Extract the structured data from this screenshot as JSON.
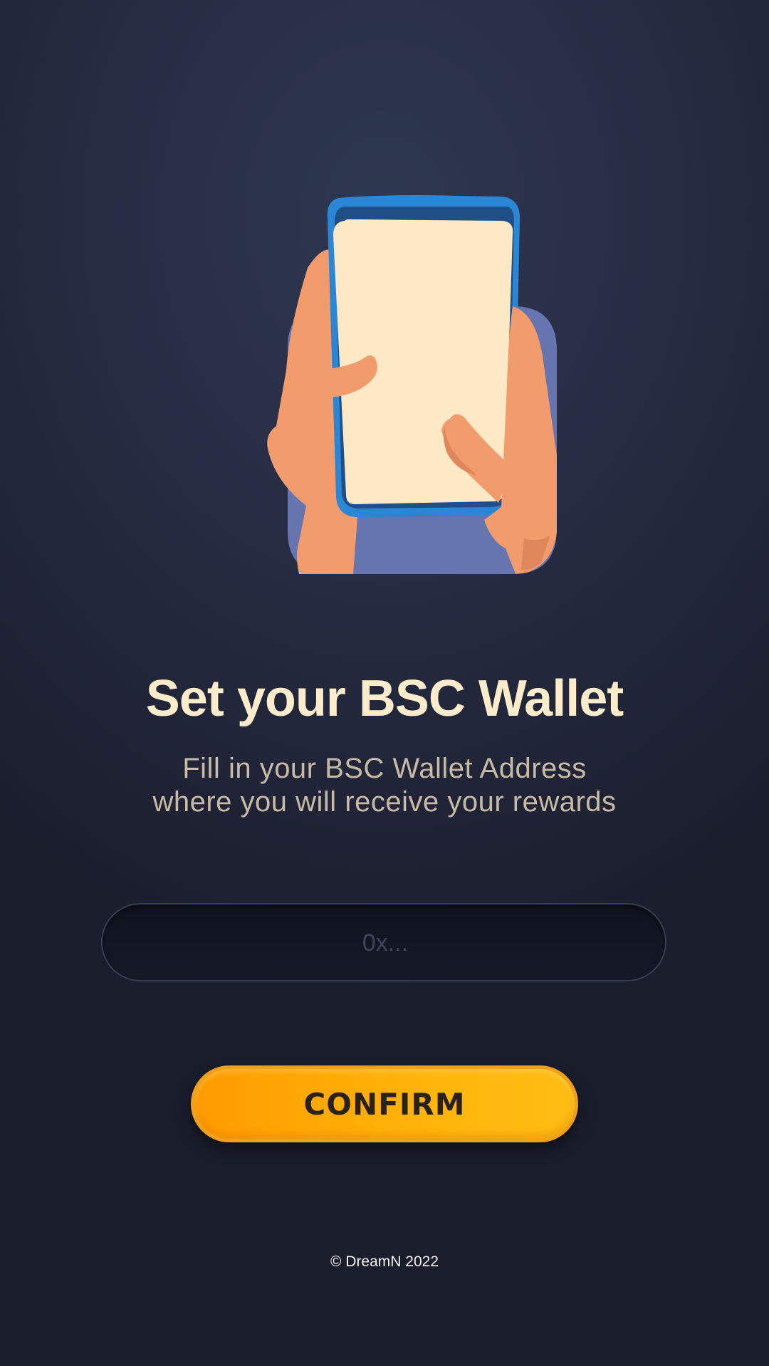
{
  "title": "Set your BSC Wallet",
  "subtitle": {
    "line1": "Fill in your BSC Wallet Address",
    "line2": "where you will receive your rewards"
  },
  "wallet_input": {
    "placeholder": "0x...",
    "value": ""
  },
  "confirm_label": "CONFIRM",
  "footer": "© DreamN 2022",
  "illustration": {
    "icon": "hands-holding-phone-icon"
  },
  "colors": {
    "title": "#fdeccb",
    "subtitle": "#c7bba7",
    "button": "#ffa800",
    "backdrop": "#6674b0",
    "phone_frame": "#2b86d6",
    "phone_screen": "#fde9c6",
    "skin": "#f29b6c"
  }
}
